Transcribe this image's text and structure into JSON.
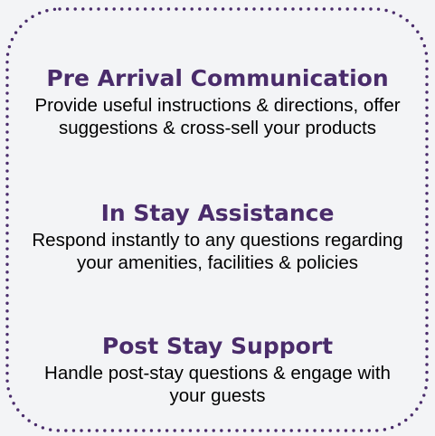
{
  "colors": {
    "heading": "#4a2c6b",
    "body": "#000000",
    "border_dots": "#4a2c6b",
    "background": "#f3f4f6"
  },
  "sections": [
    {
      "title": "Pre Arrival Communication",
      "body": "Provide useful instructions & directions, offer suggestions & cross-sell your products"
    },
    {
      "title": "In Stay Assistance",
      "body": "Respond instantly to any questions regarding your amenities, facilities & policies"
    },
    {
      "title": "Post Stay Support",
      "body": "Handle post-stay questions & engage with your guests"
    }
  ]
}
